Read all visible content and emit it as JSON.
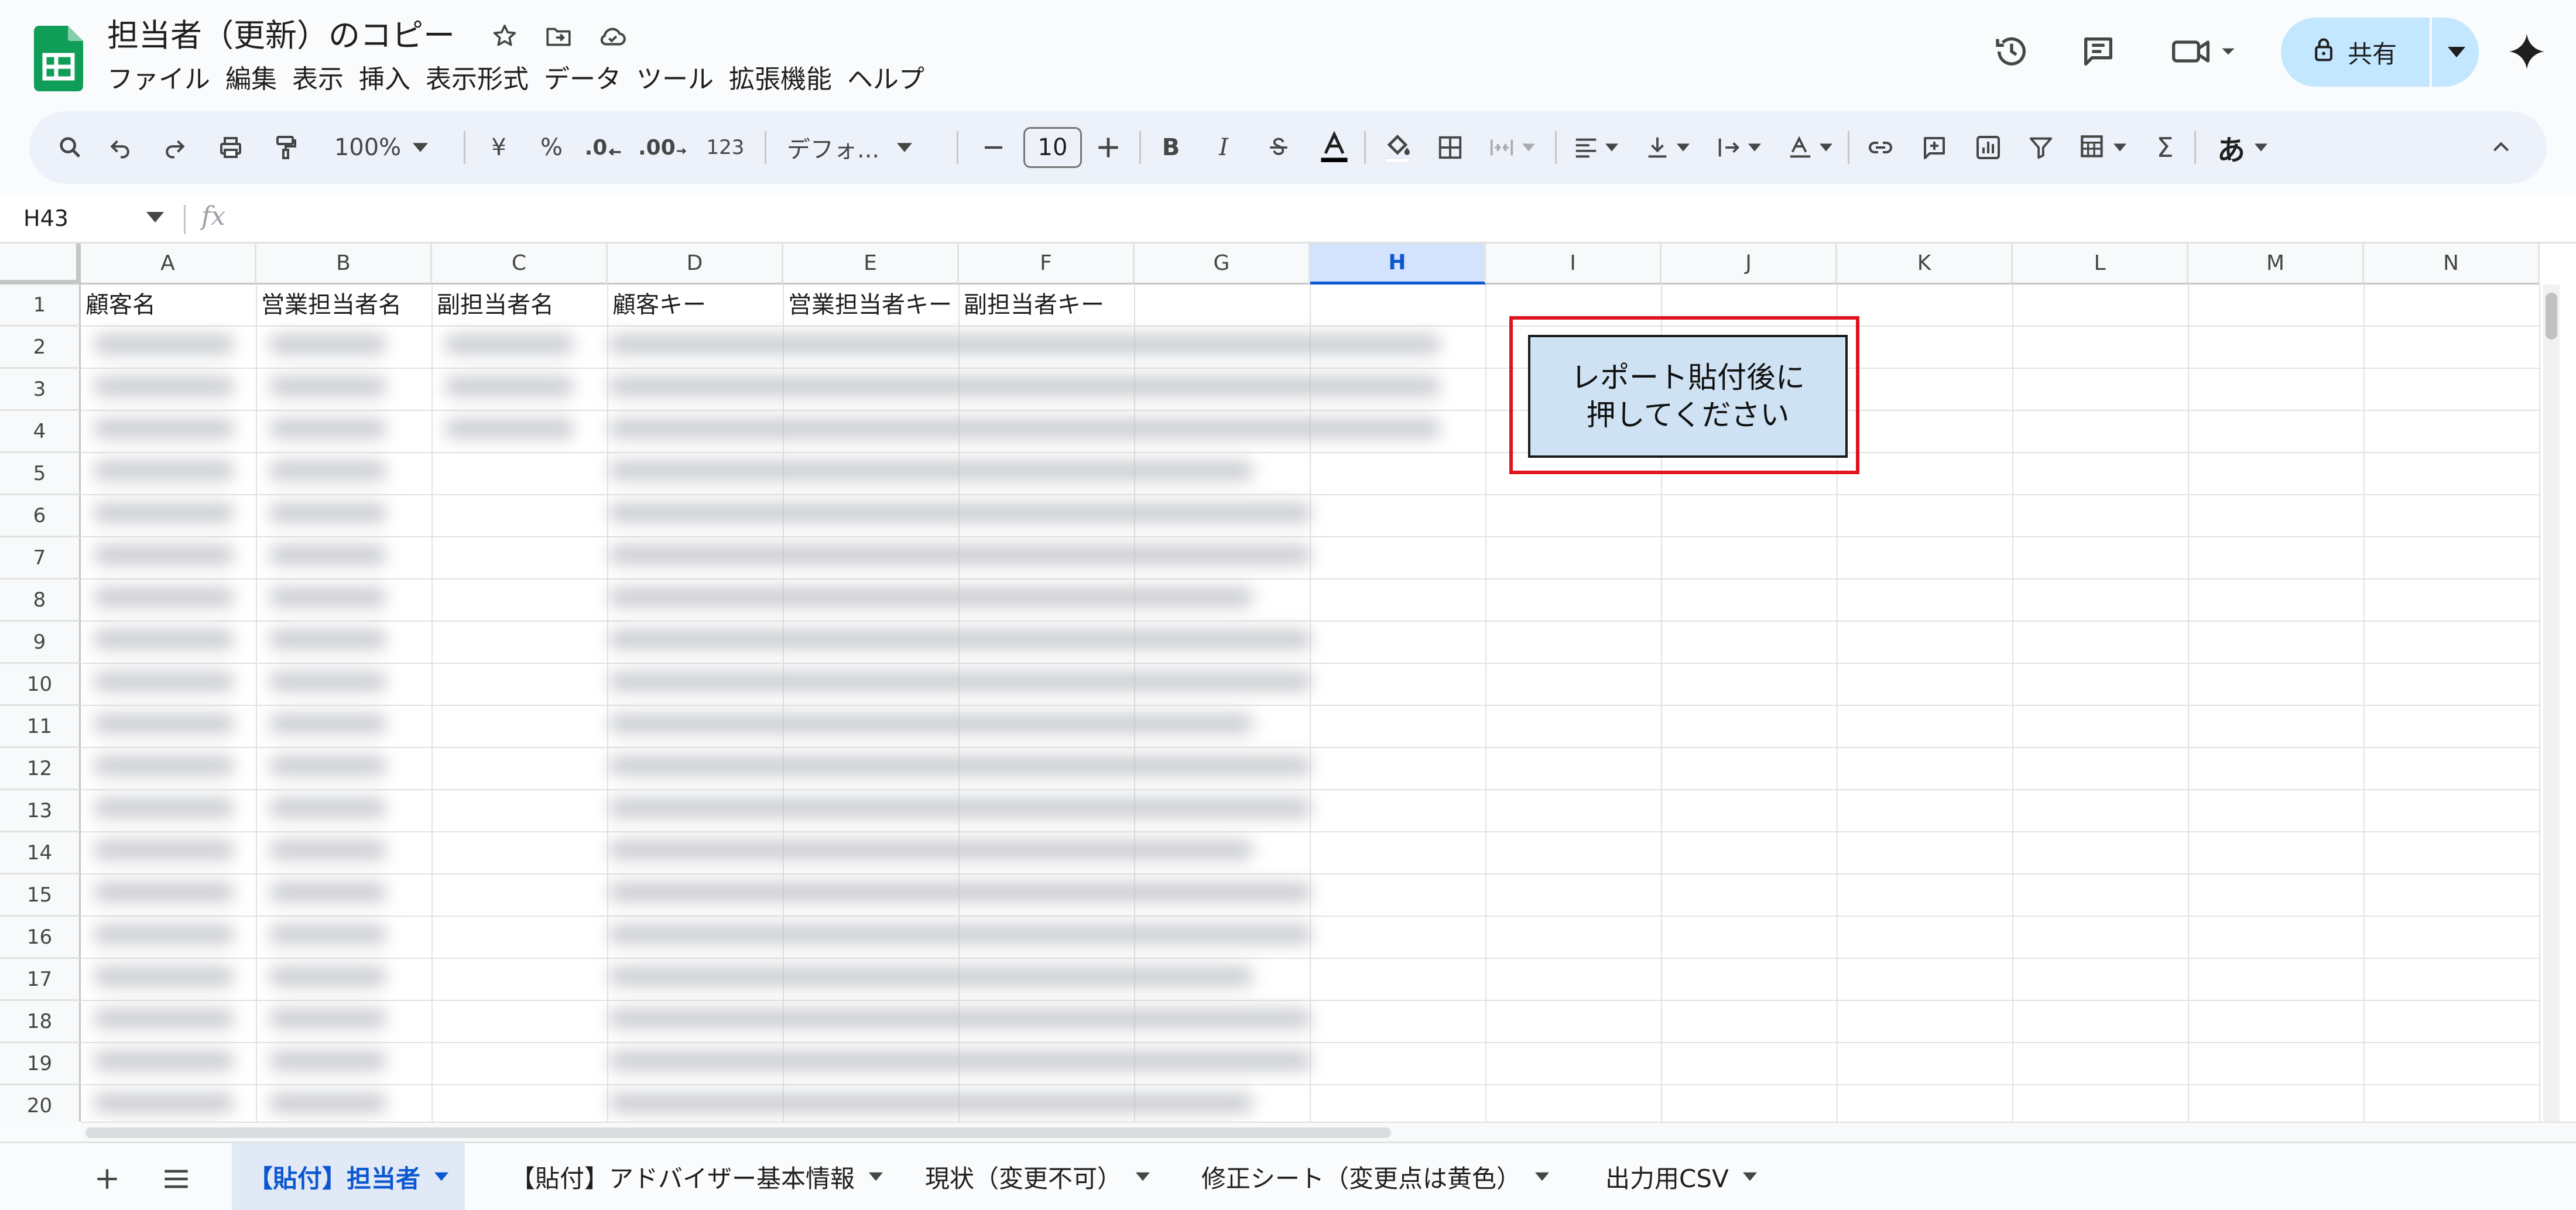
{
  "header": {
    "title": "担当者（更新）のコピー",
    "menu": [
      "ファイル",
      "編集",
      "表示",
      "挿入",
      "表示形式",
      "データ",
      "ツール",
      "拡張機能",
      "ヘルプ"
    ],
    "share_label": "共有"
  },
  "toolbar": {
    "zoom": "100%",
    "currency": "¥",
    "percent": "%",
    "decrease_decimal": ".0",
    "increase_decimal": ".00",
    "number_format": "123",
    "font": "デフォ...",
    "font_size": "10",
    "bold": "B",
    "italic": "I",
    "sigma": "Σ",
    "input_mode": "あ"
  },
  "formula_bar": {
    "name_box": "H43",
    "fx": "fx"
  },
  "grid": {
    "columns": [
      "A",
      "B",
      "C",
      "D",
      "E",
      "F",
      "G",
      "H",
      "I",
      "J",
      "K",
      "L",
      "M",
      "N"
    ],
    "selected_column": "H",
    "rows": [
      "1",
      "2",
      "3",
      "4",
      "5",
      "6",
      "7",
      "8",
      "9",
      "10",
      "11",
      "12",
      "13",
      "14",
      "15",
      "16",
      "17",
      "18",
      "19",
      "20"
    ],
    "header_row": [
      "顧客名",
      "営業担当者名",
      "副担当者名",
      "顧客キー",
      "営業担当者キー",
      "副担当者キー"
    ]
  },
  "drawing_button": {
    "line1": "レポート貼付後に",
    "line2": "押してください"
  },
  "sheet_tabs": [
    {
      "label": "【貼付】担当者",
      "active": true
    },
    {
      "label": "【貼付】アドバイザー基本情報",
      "active": false
    },
    {
      "label": "現状（変更不可）",
      "active": false
    },
    {
      "label": "修正シート（変更点は黄色）",
      "active": false
    },
    {
      "label": "出力用CSV",
      "active": false
    }
  ],
  "colors": {
    "accent": "#0b57d0",
    "share_bg": "#c2e7ff",
    "button_fill": "#cfe2f3",
    "button_frame": "#e0141e",
    "sheets_green": "#0f9d58"
  }
}
